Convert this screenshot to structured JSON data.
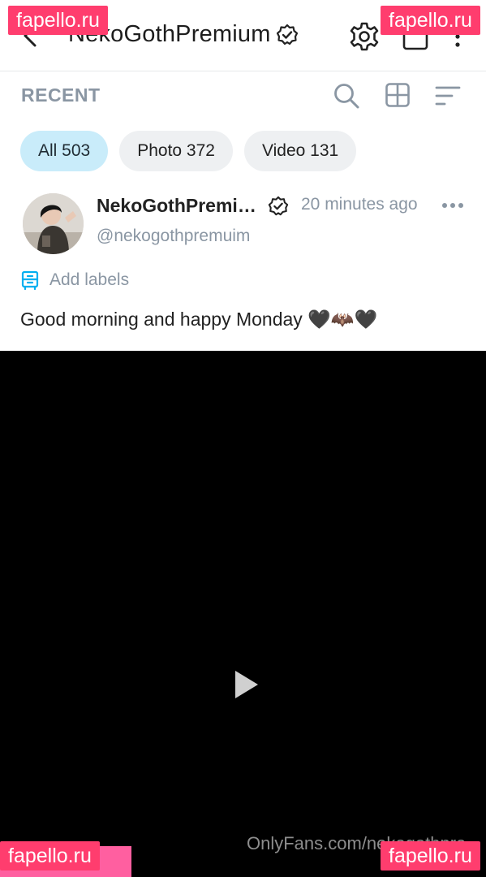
{
  "header": {
    "title": "NekoGothPremium",
    "icons": [
      "back-arrow-icon",
      "verified-badge-icon",
      "gear-icon",
      "share-icon",
      "more-vertical-icon"
    ]
  },
  "toolbar": {
    "section_label": "RECENT",
    "icons": [
      "search-icon",
      "grid-icon",
      "sort-icon"
    ]
  },
  "filters": [
    {
      "label": "All 503",
      "active": true
    },
    {
      "label": "Photo 372",
      "active": false
    },
    {
      "label": "Video 131",
      "active": false
    }
  ],
  "post": {
    "author_name": "NekoGothPremi…",
    "handle": "@nekogothpremuim",
    "time": "20 minutes ago",
    "add_labels": "Add labels",
    "text": "Good morning and happy Monday 🖤🦇🖤",
    "video_credit": "OnlyFans.com/nekogothpre"
  },
  "watermarks": {
    "top_left": "fapello.ru",
    "top_right": "fapello.ru",
    "bottom_left": "fapello.ru",
    "bottom_right": "fapello.ru"
  },
  "colors": {
    "accent_blue": "#00aff0",
    "chip_active": "#c9ecfa",
    "chip_inactive": "#eef0f2",
    "muted_text": "#8a96a3",
    "watermark": "#ff3d6e"
  }
}
